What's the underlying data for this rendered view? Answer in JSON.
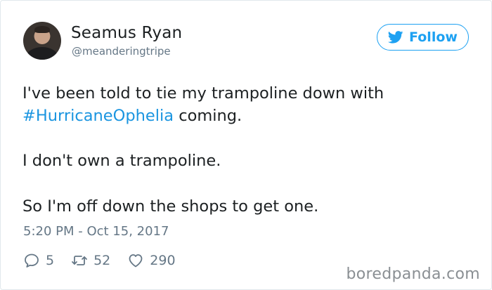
{
  "author": {
    "name": "Seamus Ryan",
    "handle": "@meanderingtripe",
    "avatar_icon": "profile-photo"
  },
  "follow_button": {
    "label": "Follow",
    "icon": "twitter-bird-icon",
    "color": "#1da1f2"
  },
  "tweet": {
    "line1": "I've been told to tie my trampoline down with",
    "hashtag": "#HurricaneOphelia",
    "line1_end": " coming.",
    "paragraph2": "I don't own a trampoline.",
    "paragraph3": "So I'm off down the shops to get one.",
    "hashtag_color": "#1b95e0"
  },
  "timestamp": "5:20 PM - Oct 15, 2017",
  "actions": {
    "replies": "5",
    "retweets": "52",
    "likes": "290"
  },
  "watermark": "boredpanda.com"
}
